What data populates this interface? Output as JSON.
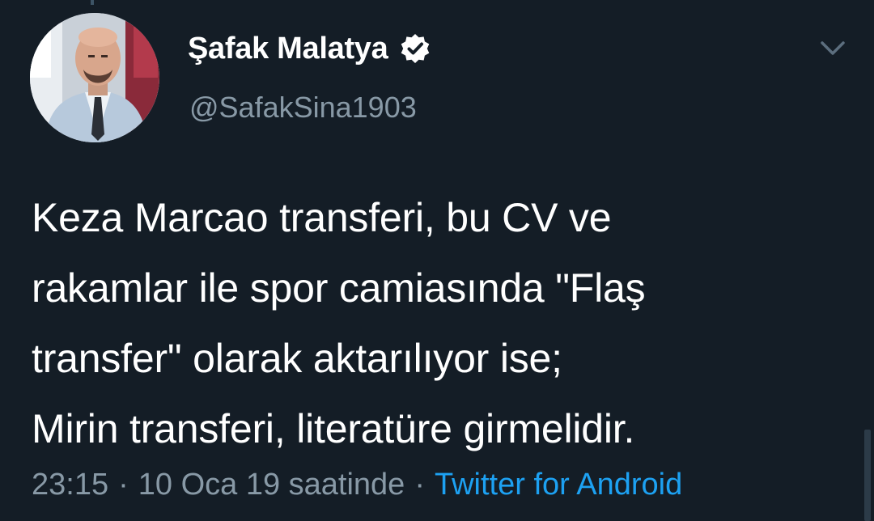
{
  "tweet": {
    "display_name": "Şafak Malatya",
    "verified": true,
    "handle": "@SafakSina1903",
    "text_lines": [
      "Keza Marcao transferi, bu CV ve",
      "rakamlar ile spor camiasında \"Flaş",
      "transfer\" olarak aktarılıyor ise;",
      "Mirin transferi, literatüre girmelidir."
    ],
    "time": "23:15",
    "separator": "·",
    "date_text": "10 Oca 19 saatinde",
    "source": "Twitter for Android"
  },
  "icons": {
    "verified": "verified-badge-icon",
    "caret": "chevron-down-icon",
    "avatar": "profile-photo"
  },
  "colors": {
    "background": "#141d26",
    "primary_text": "#ffffff",
    "secondary_text": "#8899a6",
    "link": "#1da1f2"
  }
}
